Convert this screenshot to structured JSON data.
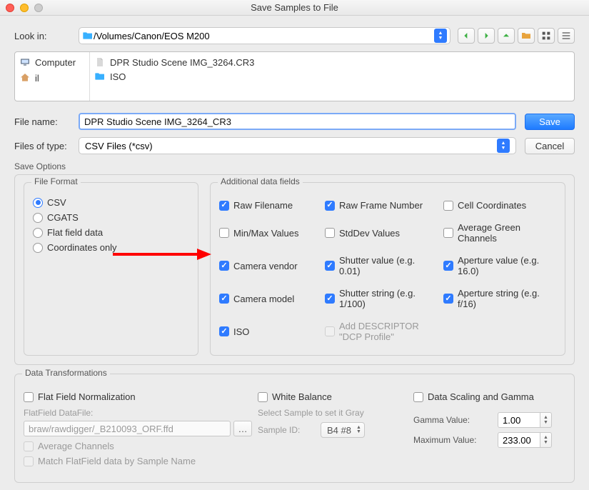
{
  "window": {
    "title": "Save Samples to File"
  },
  "lookin": {
    "label": "Look in:",
    "path": "/Volumes/Canon/EOS M200"
  },
  "sidebar": {
    "items": [
      "Computer",
      "il"
    ]
  },
  "filelist": {
    "items": [
      {
        "name": "DPR Studio Scene IMG_3264.CR3",
        "type": "file"
      },
      {
        "name": "ISO",
        "type": "folder"
      }
    ]
  },
  "filename": {
    "label": "File name:",
    "value": "DPR Studio Scene IMG_3264_CR3"
  },
  "filetype": {
    "label": "Files of type:",
    "value": "CSV Files (*csv)"
  },
  "buttons": {
    "save": "Save",
    "cancel": "Cancel"
  },
  "save_options_label": "Save Options",
  "file_format": {
    "legend": "File Format",
    "options": [
      "CSV",
      "CGATS",
      "Flat field data",
      "Coordinates only"
    ],
    "selected": "CSV"
  },
  "additional": {
    "legend": "Additional data fields",
    "fields": [
      {
        "label": "Raw Filename",
        "checked": true
      },
      {
        "label": "Raw Frame Number",
        "checked": true
      },
      {
        "label": "Cell Coordinates",
        "checked": false
      },
      {
        "label": "Min/Max Values",
        "checked": false
      },
      {
        "label": "StdDev Values",
        "checked": false
      },
      {
        "label": "Average Green Channels",
        "checked": false
      },
      {
        "label": "Camera vendor",
        "checked": true
      },
      {
        "label": "Shutter value (e.g. 0.01)",
        "checked": true
      },
      {
        "label": "Aperture value (e.g. 16.0)",
        "checked": true
      },
      {
        "label": "Camera model",
        "checked": true
      },
      {
        "label": "Shutter string (e.g. 1/100)",
        "checked": true
      },
      {
        "label": "Aperture string (e.g. f/16)",
        "checked": true
      },
      {
        "label": "ISO",
        "checked": true
      },
      {
        "label": "Add DESCRIPTOR \"DCP Profile\"",
        "checked": false,
        "disabled": true
      }
    ]
  },
  "transforms": {
    "legend": "Data Transformations",
    "flat": {
      "title": "Flat Field Normalization",
      "datafile_label": "FlatField DataFile:",
      "datafile_value": "braw/rawdigger/_B210093_ORF.ffd",
      "avg": "Average Channels",
      "match": "Match FlatField data by Sample Name"
    },
    "wb": {
      "title": "White Balance",
      "hint": "Select Sample to set it Gray",
      "sample_label": "Sample ID:",
      "sample_value": "B4 #8"
    },
    "gamma": {
      "title": "Data Scaling and Gamma",
      "gamma_label": "Gamma Value:",
      "gamma_value": "1.00",
      "max_label": "Maximum Value:",
      "max_value": "233.00"
    }
  }
}
